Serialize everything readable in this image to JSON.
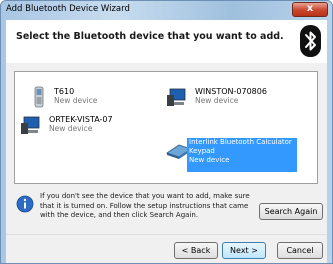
{
  "window": {
    "title": "Add Bluetooth Device Wizard",
    "close_glyph": "x"
  },
  "header": {
    "prompt": "Select the Bluetooth device that you want to add."
  },
  "devices": [
    {
      "name": "T610",
      "status": "New device",
      "icon": "phone-icon"
    },
    {
      "name": "WINSTON-070806",
      "status": "New device",
      "icon": "computer-icon"
    },
    {
      "name": "ORTEK-VISTA-07",
      "status": "New device",
      "icon": "computer-icon"
    },
    {
      "name_line1": "Interlink Bluetooth Calculator",
      "name_line2": "Keypad",
      "status": "New device",
      "icon": "keyboard-icon",
      "selected": true
    }
  ],
  "info": {
    "text": "If you don't see the device that you want to add, make sure that it is turned on. Follow the setup instructions that came with the device, and then click Search Again."
  },
  "buttons": {
    "search_again": "Search Again",
    "back": "< Back",
    "next": "Next >",
    "cancel": "Cancel"
  },
  "colors": {
    "selection": "#3399ff",
    "title_gradient": "#a9c6e4",
    "close": "#c9462c"
  }
}
